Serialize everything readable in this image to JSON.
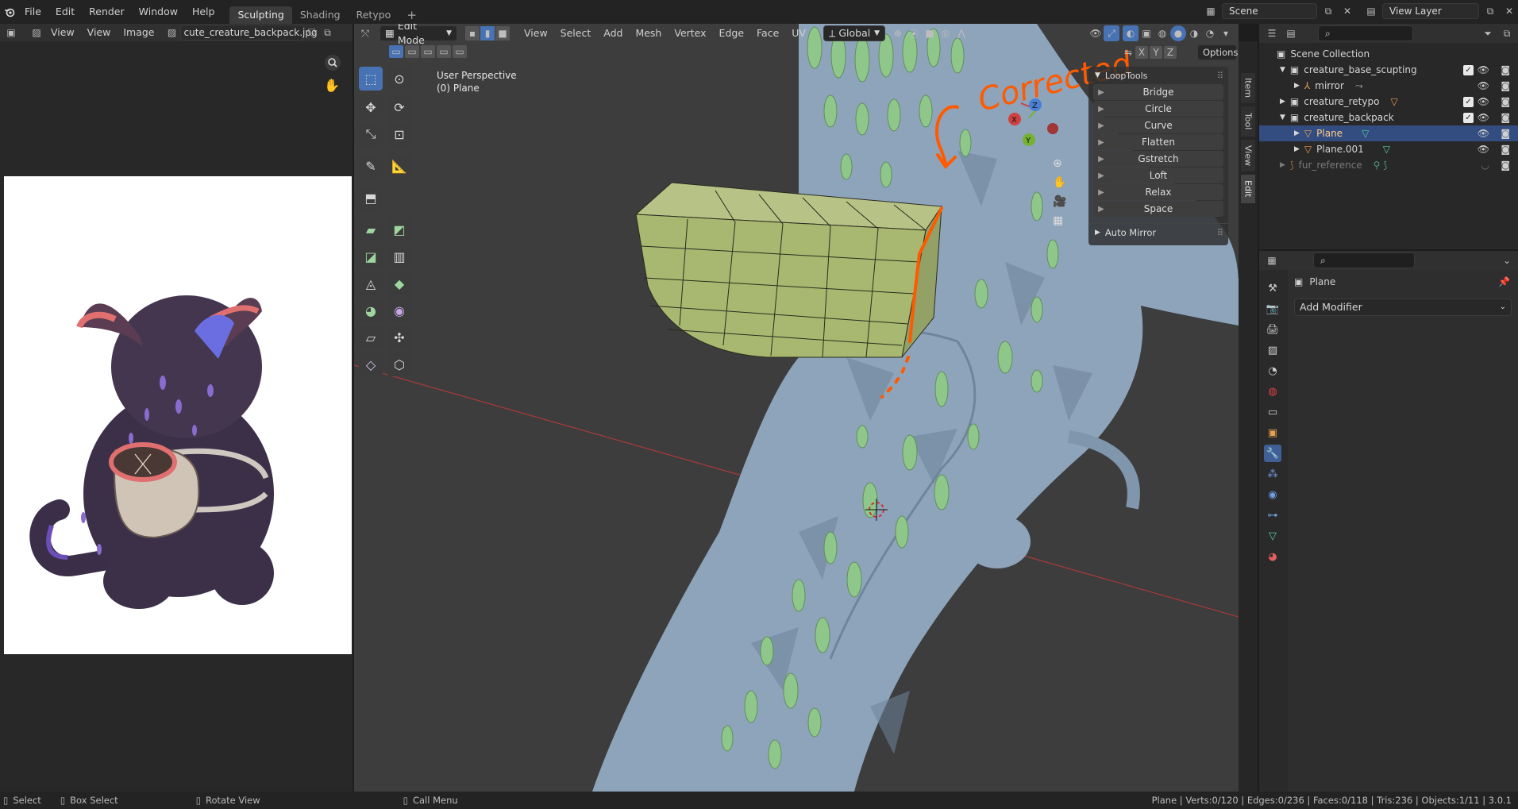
{
  "topbar": {
    "menus": [
      "File",
      "Edit",
      "Render",
      "Window",
      "Help"
    ],
    "workspaces": [
      "Sculpting",
      "Shading",
      "Retypo"
    ],
    "active_workspace": "Sculpting",
    "add_workspace": "+",
    "scene_label": "Scene",
    "view_layer_label": "View Layer"
  },
  "image_editor": {
    "menus": [
      "View",
      "View",
      "Image"
    ],
    "image_name": "cute_creature_backpack.jpg"
  },
  "viewport": {
    "mode": "Edit Mode",
    "menus": [
      "View",
      "Select",
      "Add",
      "Mesh",
      "Vertex",
      "Edge",
      "Face",
      "UV"
    ],
    "transform_orientation": "Global",
    "options_label": "Options",
    "axes": [
      "X",
      "Y",
      "Z"
    ],
    "info_line1": "User Perspective",
    "info_line2": "(0) Plane",
    "annotation_text": "Corrected",
    "gizmo_labels": {
      "x": "X",
      "y": "Y",
      "z": "Z"
    }
  },
  "looptools": {
    "title": "LoopTools",
    "items": [
      "Bridge",
      "Circle",
      "Curve",
      "Flatten",
      "Gstretch",
      "Loft",
      "Relax",
      "Space"
    ],
    "auto_mirror": "Auto Mirror"
  },
  "side_tabs": [
    "Item",
    "Tool",
    "View",
    "Edit"
  ],
  "outliner": {
    "root": "Scene Collection",
    "rows": [
      {
        "label": "creature_base_scupting",
        "indent": 1,
        "kind": "collection",
        "selected": false
      },
      {
        "label": "mirror",
        "indent": 2,
        "kind": "empty",
        "selected": false
      },
      {
        "label": "creature_retypo",
        "indent": 1,
        "kind": "collection",
        "selected": false
      },
      {
        "label": "creature_backpack",
        "indent": 1,
        "kind": "collection",
        "selected": false
      },
      {
        "label": "Plane",
        "indent": 2,
        "kind": "mesh",
        "selected": true
      },
      {
        "label": "Plane.001",
        "indent": 2,
        "kind": "mesh",
        "selected": false
      },
      {
        "label": "fur_reference",
        "indent": 1,
        "kind": "curves",
        "selected": false
      }
    ]
  },
  "properties": {
    "object_name": "Plane",
    "add_modifier": "Add Modifier"
  },
  "status": {
    "select": "Select",
    "box_select": "Box Select",
    "rotate_view": "Rotate View",
    "call_menu": "Call Menu",
    "stats": "Plane | Verts:0/120 | Edges:0/236 | Faces:0/118 | Tris:236 | Objects:1/11 | 3.0.1"
  },
  "colors": {
    "accent": "#4772b3",
    "annotation": "#ff5a00",
    "mesh_green": "#a8b870",
    "creature_blue": "#8fa6bf",
    "scale_green": "#8fc78a"
  }
}
